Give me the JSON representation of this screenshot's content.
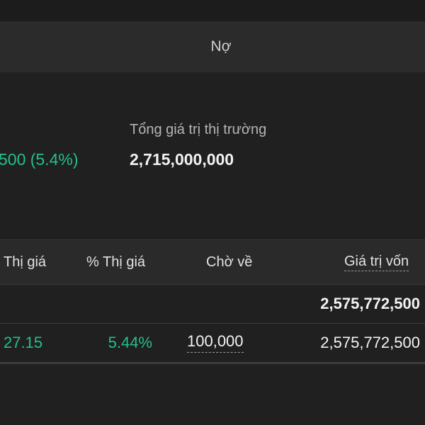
{
  "tabs": {
    "debt_label": "Nợ"
  },
  "summary": {
    "profit_loss_value": "500 (5.4%)",
    "market_value_label": "Tổng giá trị thị trường",
    "market_value": "2,715,000,000"
  },
  "table": {
    "headers": {
      "market_price": "Thị giá",
      "pct_market_price": "% Thị giá",
      "pending": "Chờ về",
      "capital_value": "Giá trị vốn"
    },
    "total_row": {
      "capital_value": "2,575,772,500"
    },
    "rows": [
      {
        "market_price": "27.15",
        "pct_market_price": "5.44%",
        "pending": "100,000",
        "capital_value": "2,575,772,500"
      }
    ]
  },
  "colors": {
    "positive": "#22c08a",
    "background": "#202020",
    "header_bg": "#2a2a2a"
  }
}
